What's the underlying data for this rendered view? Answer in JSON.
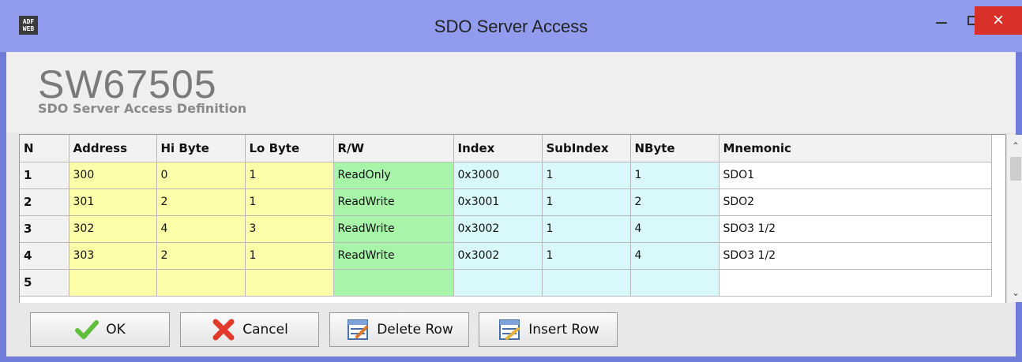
{
  "window": {
    "title": "SDO Server Access",
    "app_icon_text": "ADF WEB",
    "close_glyph": "×"
  },
  "header": {
    "product": "SW67505",
    "subtitle": "SDO Server Access Definition"
  },
  "table": {
    "columns": [
      "N",
      "Address",
      "Hi Byte",
      "Lo Byte",
      "R/W",
      "Index",
      "SubIndex",
      "NByte",
      "Mnemonic"
    ],
    "rows": [
      [
        "1",
        "300",
        "0",
        "1",
        "ReadOnly",
        "0x3000",
        "1",
        "1",
        "SDO1"
      ],
      [
        "2",
        "301",
        "2",
        "1",
        "ReadWrite",
        "0x3001",
        "1",
        "2",
        "SDO2"
      ],
      [
        "3",
        "302",
        "4",
        "3",
        "ReadWrite",
        "0x3002",
        "1",
        "4",
        "SDO3 1/2"
      ],
      [
        "4",
        "303",
        "2",
        "1",
        "ReadWrite",
        "0x3002",
        "1",
        "4",
        "SDO3 1/2"
      ],
      [
        "5",
        "",
        "",
        "",
        "",
        "",
        "",
        "",
        ""
      ]
    ]
  },
  "buttons": {
    "ok": "OK",
    "cancel": "Cancel",
    "delete_row": "Delete Row",
    "insert_row": "Insert Row"
  },
  "colors": {
    "address_cells": "#fefea8",
    "rw_cells": "#a8f4a8",
    "index_cells": "#d8f8fc",
    "close_button": "#d9302a",
    "titlebar": "#929cef"
  }
}
